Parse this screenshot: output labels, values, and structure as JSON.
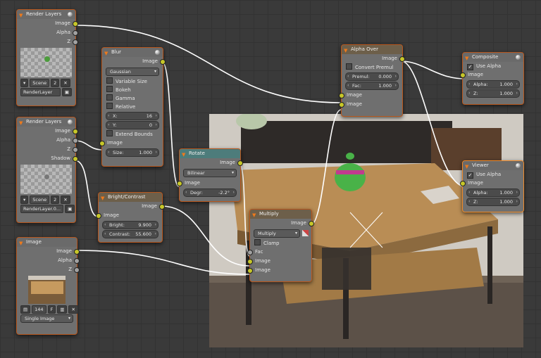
{
  "nodes": {
    "render_layers_1": {
      "title": "Render Layers",
      "outputs": [
        "Image",
        "Alpha",
        "Z"
      ],
      "scene_label": "Scene",
      "scene_num": "2",
      "layer": "RenderLayer"
    },
    "render_layers_2": {
      "title": "Render Layers",
      "outputs": [
        "Image",
        "Alpha",
        "Z",
        "Shadow"
      ],
      "scene_label": "Scene",
      "scene_num": "2",
      "layer": "RenderLayer.0..."
    },
    "image": {
      "title": "Image",
      "outputs": [
        "Image",
        "Alpha",
        "Z"
      ],
      "frame_label": "144",
      "file_label": "F",
      "source": "Single Image"
    },
    "blur": {
      "title": "Blur",
      "output": "Image",
      "filter": "Gaussian",
      "checks": [
        "Variable Size",
        "Bokeh",
        "Gamma",
        "Relative"
      ],
      "x_label": "X:",
      "x": "16",
      "y_label": "Y:",
      "y": "0",
      "extend": "Extend Bounds",
      "input": "Image",
      "size_label": "Size:",
      "size": "1.000"
    },
    "bright_contrast": {
      "title": "Bright/Contrast",
      "output": "Image",
      "input": "Image",
      "bright_label": "Bright:",
      "bright": "9.900",
      "contrast_label": "Contrast:",
      "contrast": "55.600"
    },
    "rotate": {
      "title": "Rotate",
      "output": "Image",
      "filter": "Bilinear",
      "input": "Image",
      "degr_label": "Degr:",
      "degr": "-2.2°"
    },
    "multiply": {
      "title": "Multiply",
      "output": "Image",
      "blend": "Multiply",
      "clamp": "Clamp",
      "inputs": [
        "Fac",
        "Image",
        "Image"
      ]
    },
    "alpha_over": {
      "title": "Alpha Over",
      "output": "Image",
      "convert": "Convert Premul",
      "premul_label": "Premul:",
      "premul": "0.000",
      "fac_label": "Fac:",
      "fac": "1.000",
      "inputs": [
        "Image",
        "Image"
      ]
    },
    "composite": {
      "title": "Composite",
      "use_alpha": "Use Alpha",
      "input": "Image",
      "alpha_label": "Alpha:",
      "alpha": "1.000",
      "z_label": "Z:",
      "z": "1.000"
    },
    "viewer": {
      "title": "Viewer",
      "use_alpha": "Use Alpha",
      "input": "Image",
      "alpha_label": "Alpha:",
      "alpha": "1.000",
      "z_label": "Z:",
      "z": "1.000"
    }
  },
  "colors": {
    "socket_color": "#c7c729",
    "socket_value": "#a1a1a1",
    "wire": "#ffffff",
    "node_border": "#b8561c"
  }
}
